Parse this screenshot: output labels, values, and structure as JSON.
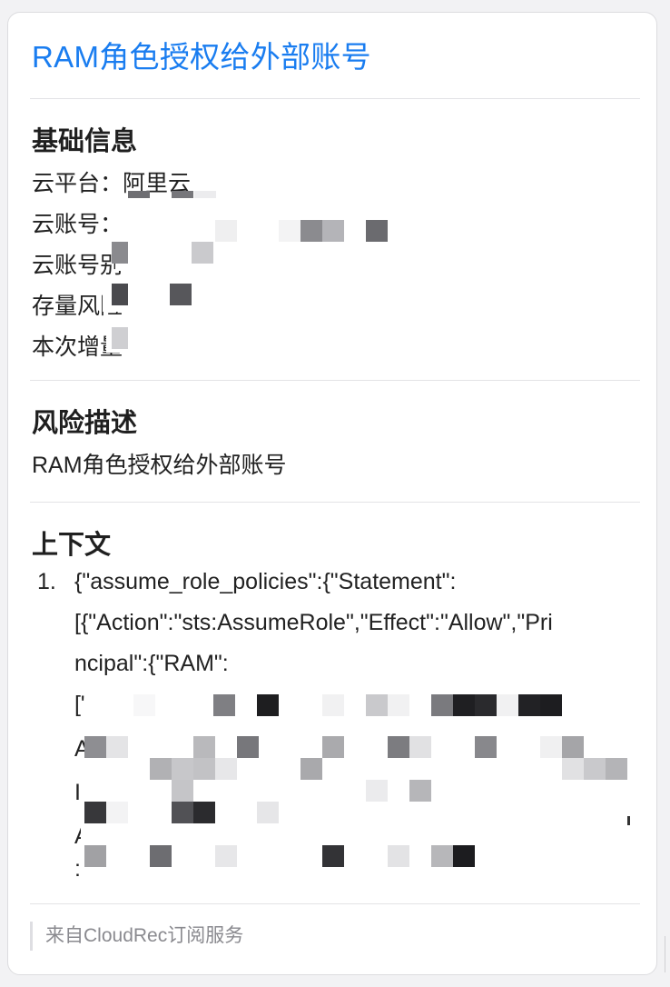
{
  "title": "RAM角色授权给外部账号",
  "basic": {
    "heading": "基础信息",
    "platform": "云平台：阿里云",
    "account": "云账号：",
    "account_alias": "云账号别",
    "existing_risk": "存量风险",
    "new_this_time": "本次增量"
  },
  "risk": {
    "heading": "风险描述",
    "text": "RAM角色授权给外部账号"
  },
  "context": {
    "heading": "上下文",
    "item_number": "1.",
    "lines": [
      "{\"assume_role_policies\":{\"Statement\":",
      "[{\"Action\":\"sts:AssumeRole\",\"Effect\":\"Allow\",\"Pri",
      "ncipal\":{\"RAM\":",
      "[\"",
      "A",
      "I",
      "A",
      ":"
    ]
  },
  "footer": "来自CloudRec订阅服务",
  "colors": {
    "title": "#1a7df0",
    "text": "#222222",
    "divider": "#e3e3e6",
    "footer": "#8a8a8f"
  }
}
